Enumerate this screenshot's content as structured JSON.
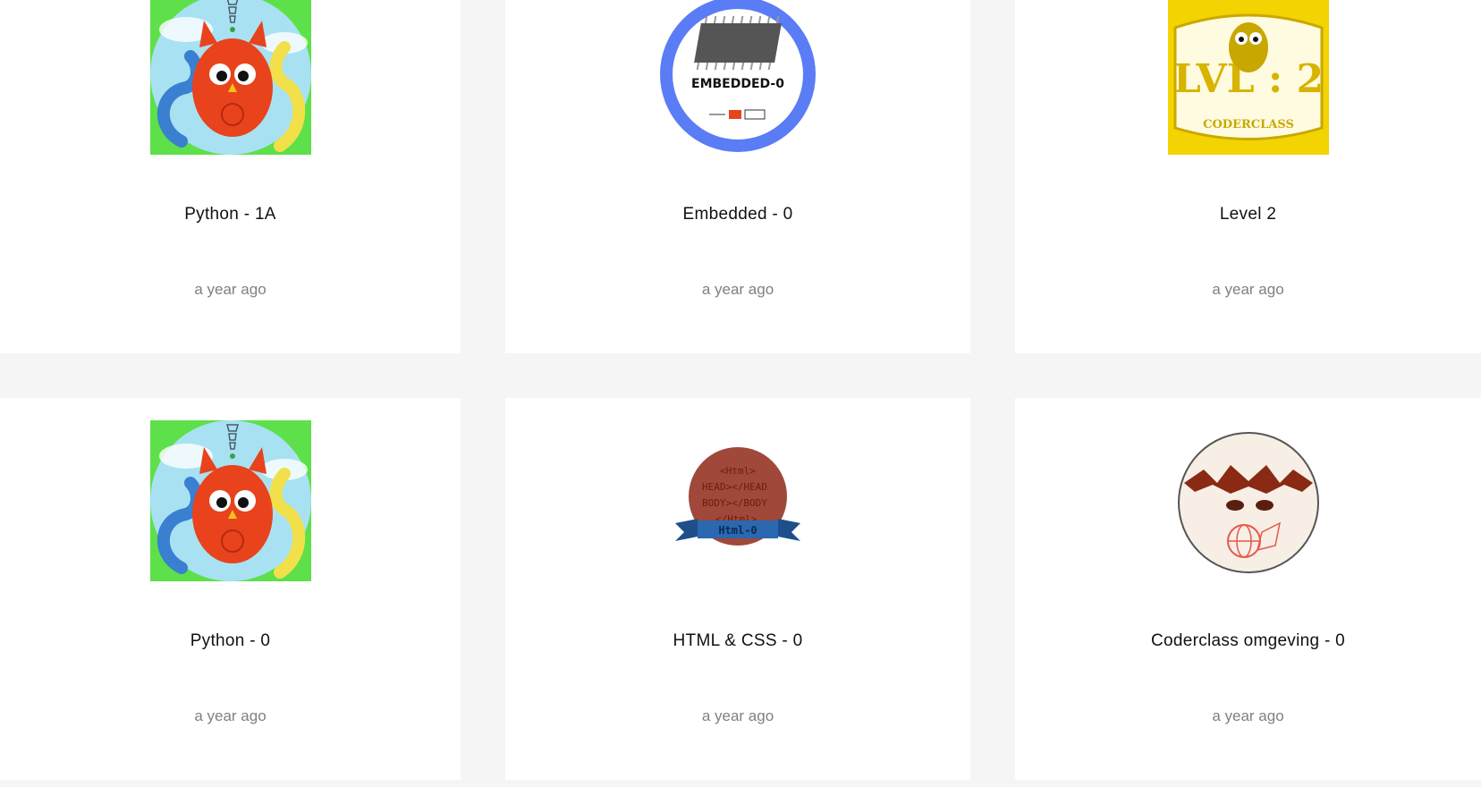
{
  "cards": [
    {
      "title": "Python - 1A",
      "date": "a year ago",
      "icon": "python-owl-badge-icon"
    },
    {
      "title": "Embedded - 0",
      "date": "a year ago",
      "icon": "embedded-chip-badge-icon",
      "badge_text": "EMBEDDED-0"
    },
    {
      "title": "Level 2",
      "date": "a year ago",
      "icon": "level-2-owl-badge-icon",
      "badge_text": "LVL : 2",
      "badge_subtext": "CODERCLASS"
    },
    {
      "title": "Python - 0",
      "date": "a year ago",
      "icon": "python-owl-badge-icon"
    },
    {
      "title": "HTML & CSS - 0",
      "date": "a year ago",
      "icon": "html-css-badge-icon",
      "badge_text": "Html-0"
    },
    {
      "title": "Coderclass omgeving - 0",
      "date": "a year ago",
      "icon": "coderclass-environment-badge-icon"
    }
  ],
  "colors": {
    "background": "#f5f5f5",
    "card": "#ffffff",
    "title": "#111111",
    "date": "#808080"
  }
}
